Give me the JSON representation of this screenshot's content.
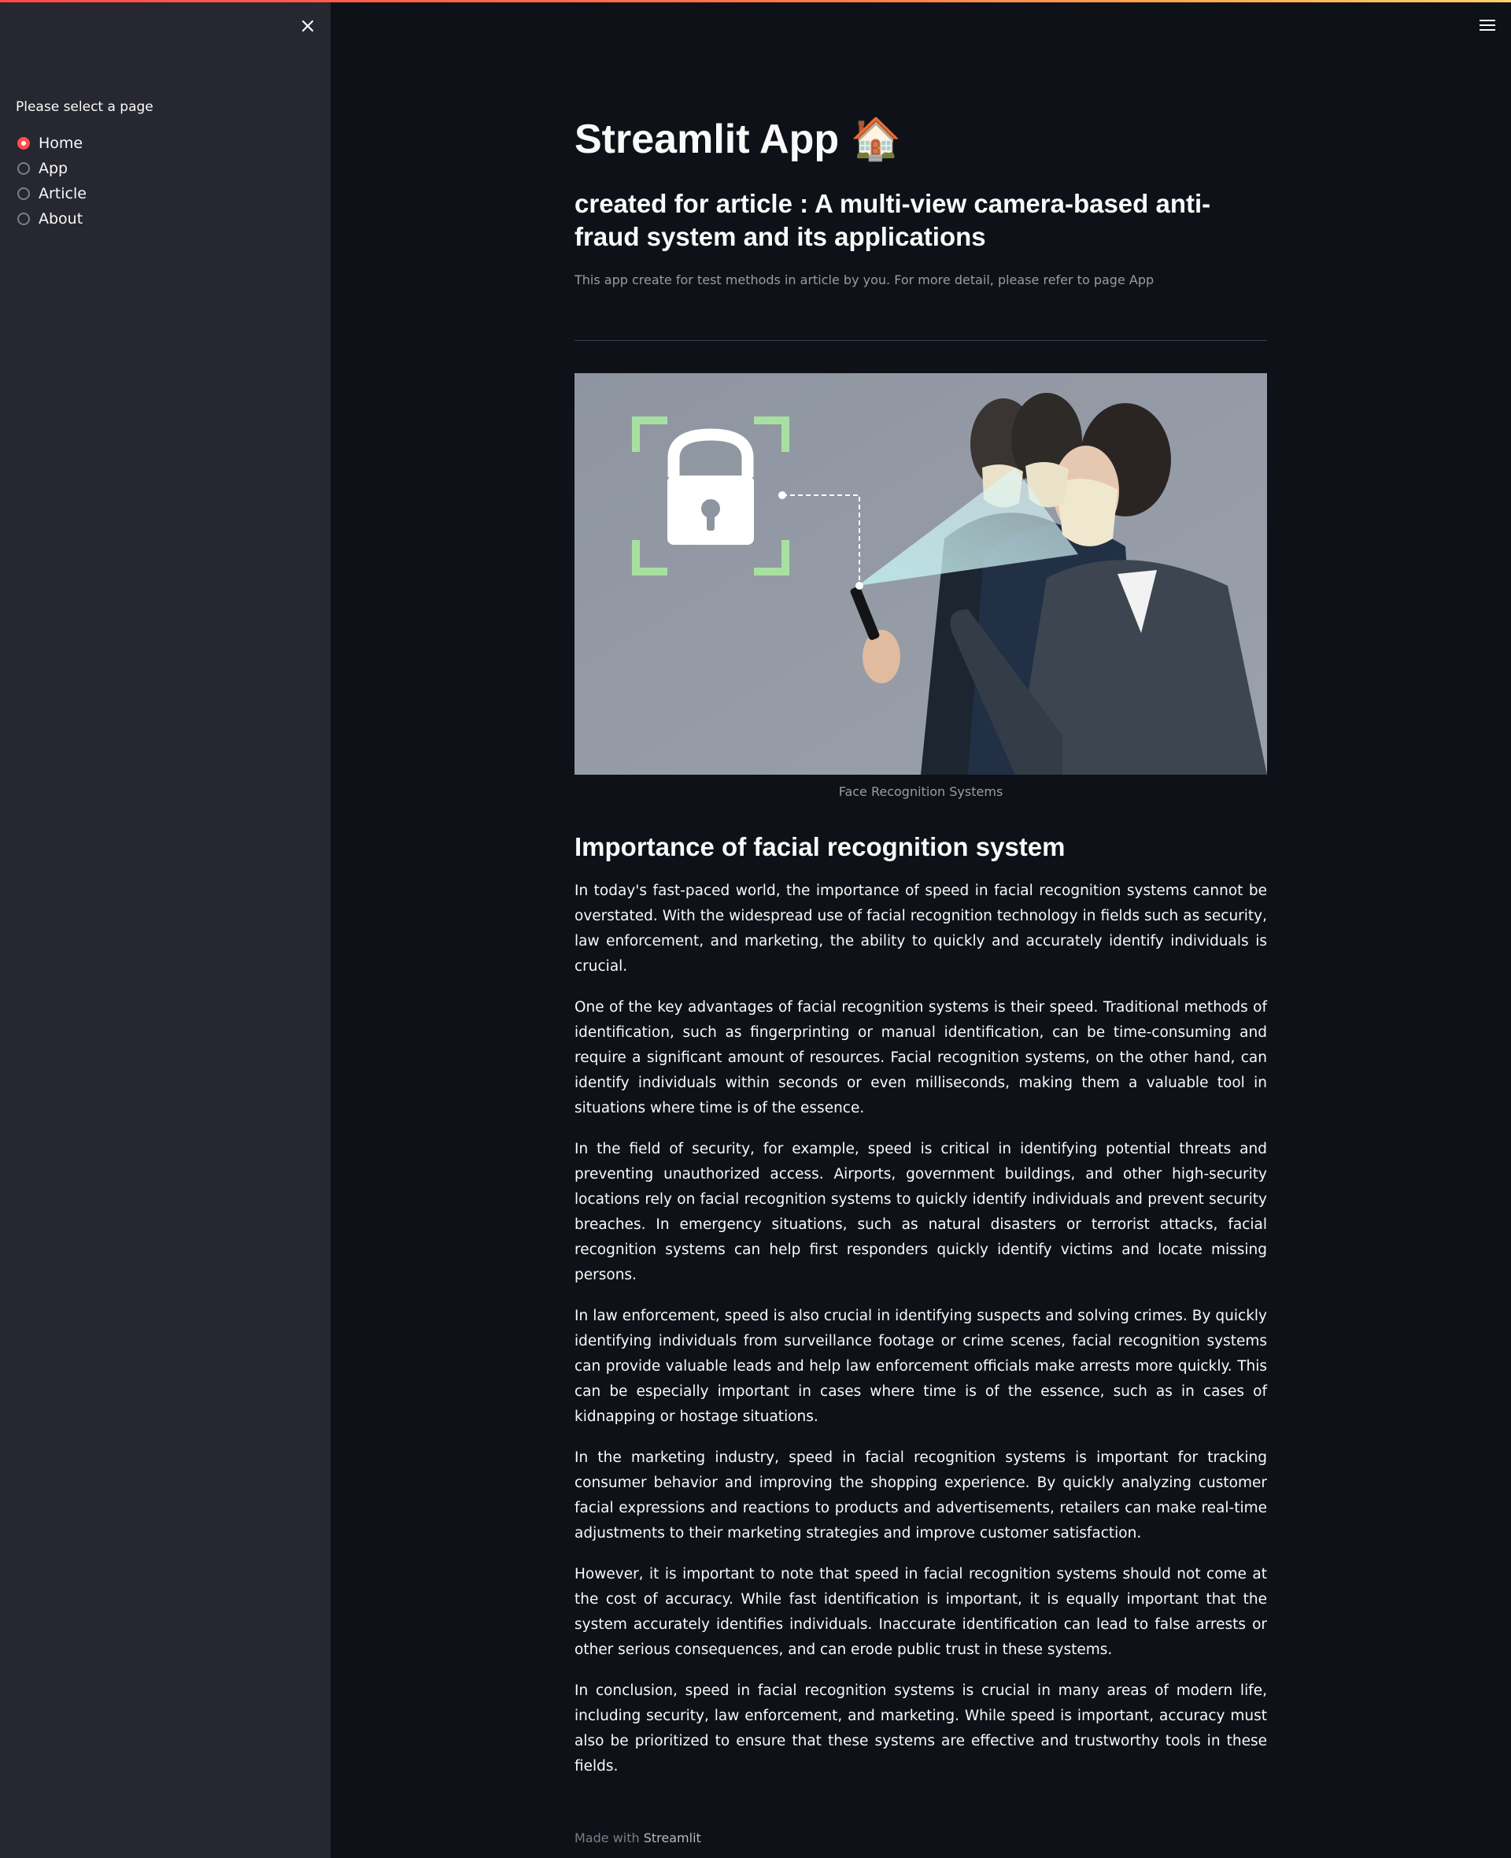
{
  "sidebar": {
    "label": "Please select a page",
    "pages": [
      {
        "label": "Home",
        "selected": true
      },
      {
        "label": "App",
        "selected": false
      },
      {
        "label": "Article",
        "selected": false
      },
      {
        "label": "About",
        "selected": false
      }
    ],
    "close_icon": "close-icon"
  },
  "header": {
    "menu_icon": "hamburger-menu-icon"
  },
  "main": {
    "title": "Streamlit App",
    "title_emoji": "🏠",
    "subtitle": "created for article : A multi-view camera-based anti-fraud system and its applications",
    "caption": "This app create for test methods in article by you. For more detail, please refer to page App",
    "image_caption": "Face Recognition Systems",
    "section_heading": "Importance of facial recognition system",
    "paragraphs": [
      "In today's fast-paced world, the importance of speed in facial recognition systems cannot be overstated. With the widespread use of facial recognition technology in fields such as security, law enforcement, and marketing, the ability to quickly and accurately identify individuals is crucial.",
      "One of the key advantages of facial recognition systems is their speed. Traditional methods of identification, such as fingerprinting or manual identification, can be time-consuming and require a significant amount of resources. Facial recognition systems, on the other hand, can identify individuals within seconds or even milliseconds, making them a valuable tool in situations where time is of the essence.",
      "In the field of security, for example, speed is critical in identifying potential threats and preventing unauthorized access. Airports, government buildings, and other high-security locations rely on facial recognition systems to quickly identify individuals and prevent security breaches. In emergency situations, such as natural disasters or terrorist attacks, facial recognition systems can help first responders quickly identify victims and locate missing persons.",
      "In law enforcement, speed is also crucial in identifying suspects and solving crimes. By quickly identifying individuals from surveillance footage or crime scenes, facial recognition systems can provide valuable leads and help law enforcement officials make arrests more quickly. This can be especially important in cases where time is of the essence, such as in cases of kidnapping or hostage situations.",
      "In the marketing industry, speed in facial recognition systems is important for tracking consumer behavior and improving the shopping experience. By quickly analyzing customer facial expressions and reactions to products and advertisements, retailers can make real-time adjustments to their marketing strategies and improve customer satisfaction.",
      "However, it is important to note that speed in facial recognition systems should not come at the cost of accuracy. While fast identification is important, it is equally important that the system accurately identifies individuals. Inaccurate identification can lead to false arrests or other serious consequences, and can erode public trust in these systems.",
      "In conclusion, speed in facial recognition systems is crucial in many areas of modern life, including security, law enforcement, and marketing. While speed is important, accuracy must also be prioritized to ensure that these systems are effective and trustworthy tools in these fields."
    ]
  },
  "footer": {
    "prefix": "Made with",
    "brand": "Streamlit"
  },
  "colors": {
    "background": "#0e1117",
    "sidebar": "#262730",
    "accent": "#ff4b4b",
    "text": "#fafafa",
    "muted": "#9a9ca4"
  }
}
